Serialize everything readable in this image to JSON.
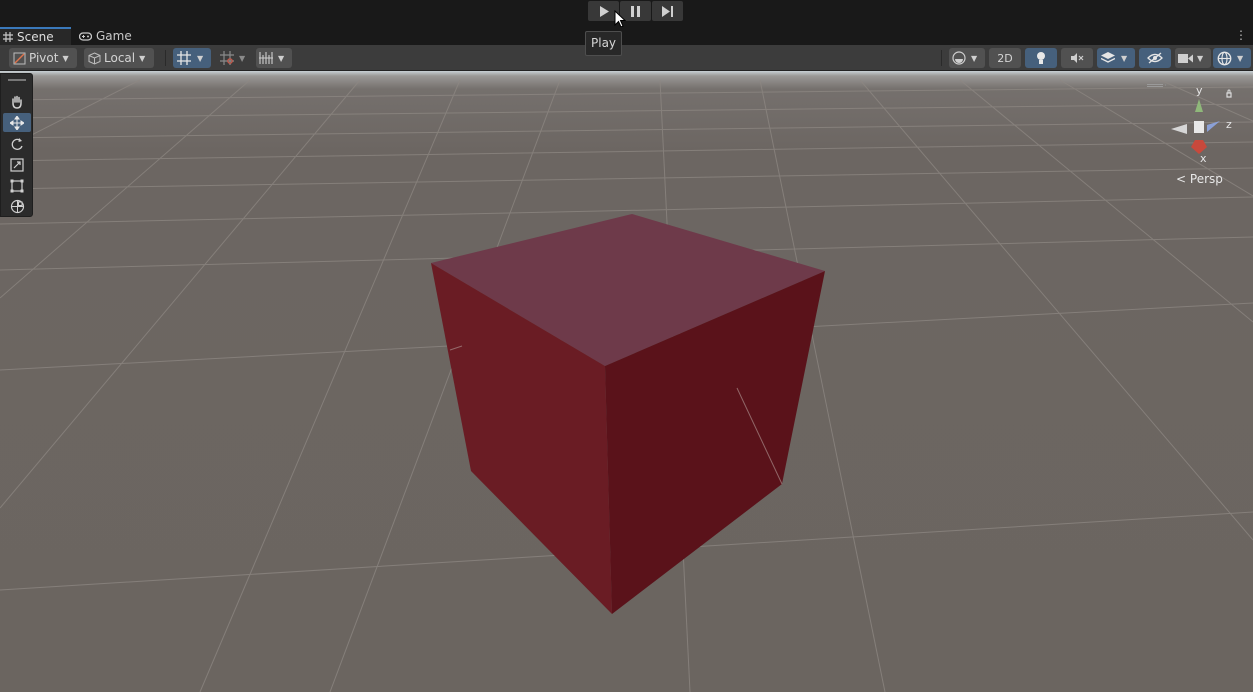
{
  "playbar": {
    "play_icon": "play-icon",
    "pause_icon": "pause-icon",
    "step_icon": "step-icon",
    "tooltip": "Play"
  },
  "tabs": [
    {
      "label": "Scene",
      "icon": "grid-icon",
      "active": true
    },
    {
      "label": "Game",
      "icon": "gamepad-icon",
      "active": false
    }
  ],
  "toolbar": {
    "pivot_label": "Pivot",
    "local_label": "Local",
    "mode_2d_label": "2D"
  },
  "gizmo": {
    "y_label": "y",
    "z_label": "z",
    "x_label": "x",
    "projection_label": "Persp"
  },
  "colors": {
    "accent": "#46607c",
    "cube_top": "#6e3a4a",
    "cube_left": "#6a1c24",
    "cube_right": "#5a121a",
    "ground": "#6b6560"
  }
}
